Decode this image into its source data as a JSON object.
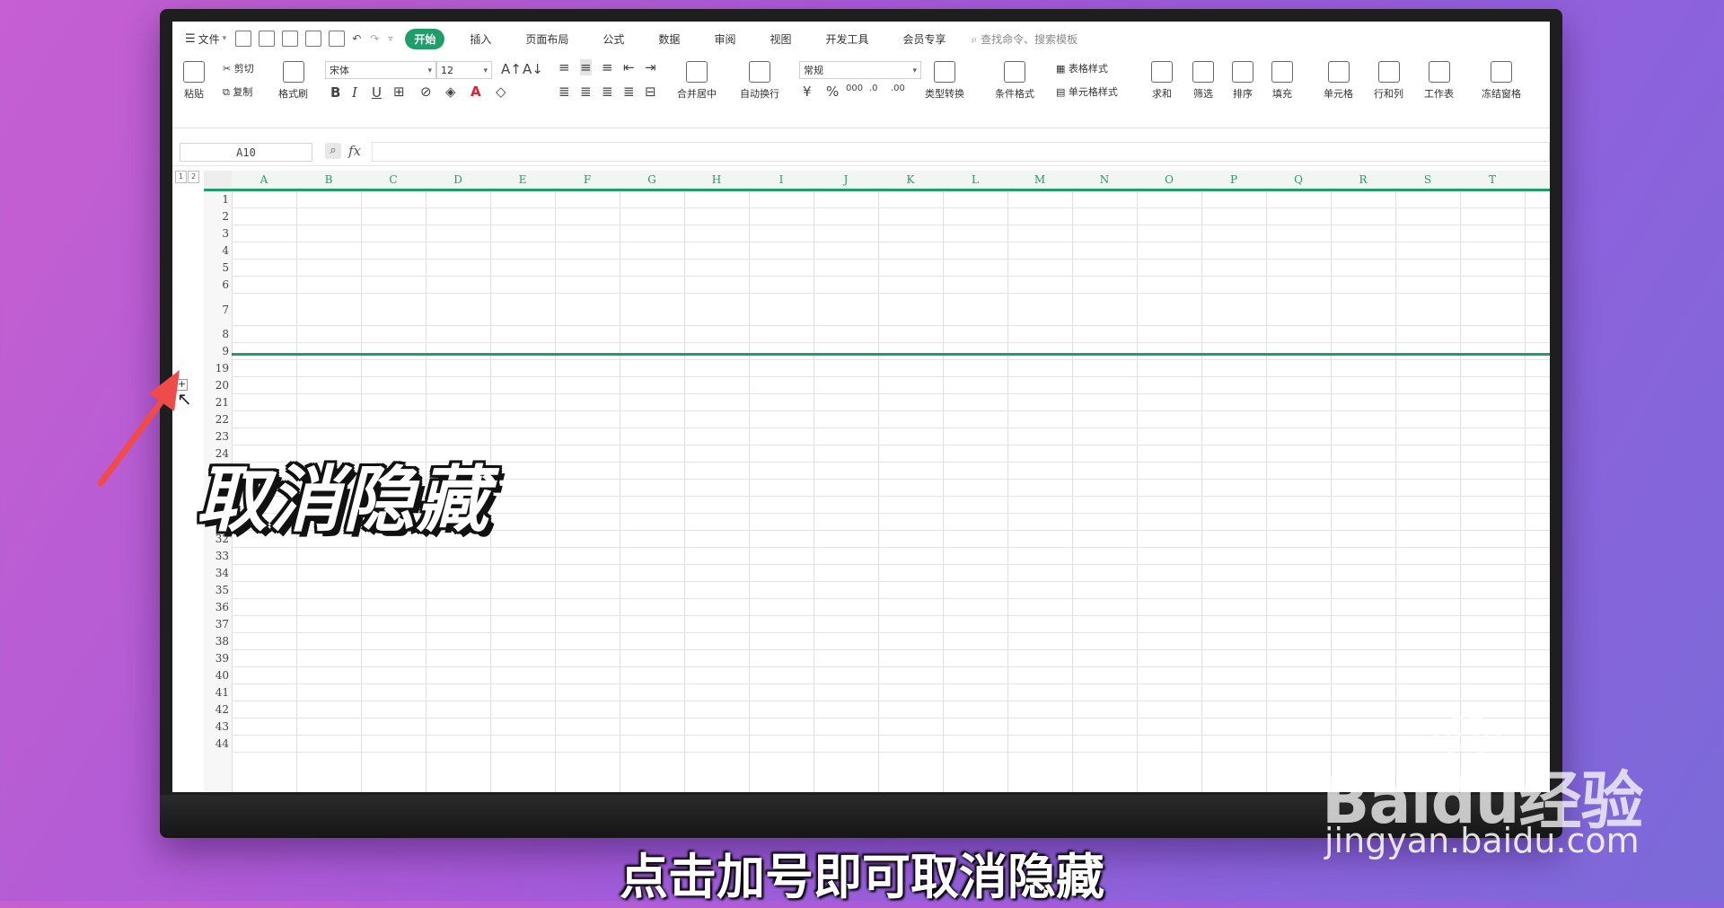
{
  "tabs": {
    "file": "文件",
    "items": [
      "开始",
      "插入",
      "页面布局",
      "公式",
      "数据",
      "审阅",
      "视图",
      "开发工具",
      "会员专享"
    ],
    "active_index": 0,
    "search_placeholder": "查找命令、搜索模板"
  },
  "ribbon": {
    "paste": "粘贴",
    "cut": "剪切",
    "copy": "复制",
    "format_painter": "格式刷",
    "font_name": "宋体",
    "font_size": "12",
    "merge_center": "合并居中",
    "wrap_text": "自动换行",
    "number_format": "常规",
    "type_convert": "类型转换",
    "conditional_format": "条件格式",
    "table_style": "表格样式",
    "cell_style": "单元格样式",
    "sum": "求和",
    "filter": "筛选",
    "sort": "排序",
    "fill": "填充",
    "cell": "单元格",
    "row_col": "行和列",
    "worksheet": "工作表",
    "freeze": "冻结窗格"
  },
  "formula_bar": {
    "name_box": "A10",
    "fx": "fx",
    "value": ""
  },
  "grid": {
    "group_levels": [
      "1",
      "2"
    ],
    "columns": [
      "A",
      "B",
      "C",
      "D",
      "E",
      "F",
      "G",
      "H",
      "I",
      "J",
      "K",
      "L",
      "M",
      "N",
      "O",
      "P",
      "Q",
      "R",
      "S",
      "T"
    ],
    "rows": [
      "1",
      "2",
      "3",
      "4",
      "5",
      "6",
      "7",
      "8",
      "9",
      "19",
      "20",
      "21",
      "22",
      "23",
      "24",
      "28",
      "29",
      "30",
      "31",
      "32",
      "33",
      "34",
      "35",
      "36",
      "37",
      "38",
      "39",
      "40",
      "41",
      "42",
      "43",
      "44"
    ],
    "expand_button": "+"
  },
  "overlay": {
    "big_caption": "取消隐藏",
    "subtitle": "点击加号即可取消隐藏",
    "watermark_brand": "Baidu经验",
    "watermark_url": "jingyan.baidu.com"
  },
  "colors": {
    "accent": "#1f9e6a",
    "background_start": "#c65fd1",
    "background_end": "#7b6ad8"
  }
}
